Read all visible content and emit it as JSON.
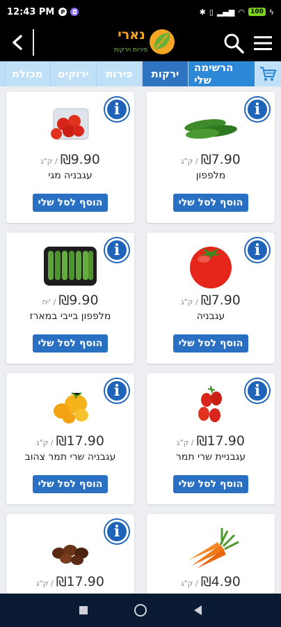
{
  "status": {
    "time": "12:43 PM",
    "battery": "100"
  },
  "header": {
    "logo_name": "נארי",
    "logo_tagline": "פירות וירקות"
  },
  "tabs": [
    {
      "label": "הרשימה שלי",
      "kind": "mylist"
    },
    {
      "label": "ירקות",
      "kind": "active"
    },
    {
      "label": "פירות",
      "kind": "normal"
    },
    {
      "label": "ירוקים",
      "kind": "normal"
    },
    {
      "label": "מכולת",
      "kind": "normal"
    }
  ],
  "add_label": "הוסף לסל שלי",
  "currency": "₪",
  "products": [
    {
      "name": "מלפפון",
      "price": "7.90",
      "unit": "ק\"ג /",
      "image": "cucumber"
    },
    {
      "name": "עגבניה מגי",
      "price": "9.90",
      "unit": "ק\"ג /",
      "image": "cherry-tomato-box"
    },
    {
      "name": "עגבניה",
      "price": "7.90",
      "unit": "ק\"ג /",
      "image": "tomato"
    },
    {
      "name": "מלפפון בייבי במארז",
      "price": "9.90",
      "unit": "יח' /",
      "image": "baby-cucumber-tray"
    },
    {
      "name": "עגבניית שרי תמר",
      "price": "17.90",
      "unit": "ק\"ג /",
      "image": "cherry-tomatoes"
    },
    {
      "name": "עגבניה שרי תמר צהוב",
      "price": "17.90",
      "unit": "ק\"ג /",
      "image": "yellow-tomatoes"
    },
    {
      "name": "",
      "price": "4.90",
      "unit": "ק\"ג /",
      "image": "carrots"
    },
    {
      "name": "",
      "price": "17.90",
      "unit": "ק\"ג /",
      "image": "dark-tomatoes"
    }
  ]
}
